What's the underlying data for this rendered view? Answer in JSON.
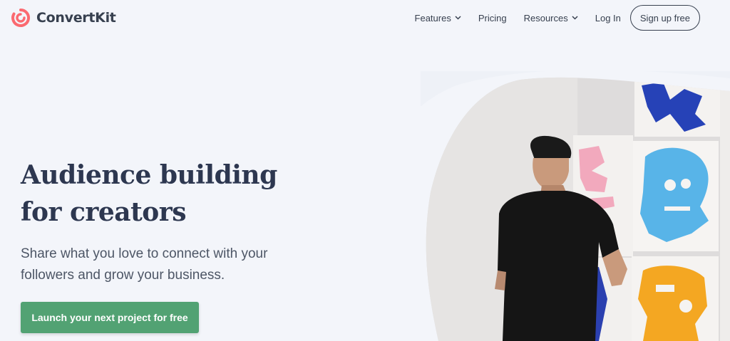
{
  "brand": {
    "name": "ConvertKit",
    "logo_color": "#fb6970"
  },
  "nav": {
    "items": [
      {
        "label": "Features",
        "has_dropdown": true
      },
      {
        "label": "Pricing",
        "has_dropdown": false
      },
      {
        "label": "Resources",
        "has_dropdown": true
      },
      {
        "label": "Log In",
        "has_dropdown": false
      }
    ],
    "signup_label": "Sign up free"
  },
  "hero": {
    "title_lines": [
      "Audience building",
      "for creators"
    ],
    "subtitle_lines": [
      "Share what you love to connect with your",
      "followers and grow your business."
    ],
    "cta_label": "Launch your next project for free",
    "cta_color": "#52a273"
  },
  "icons": [
    "convertkit-logo-icon",
    "chevron-down-icon"
  ]
}
